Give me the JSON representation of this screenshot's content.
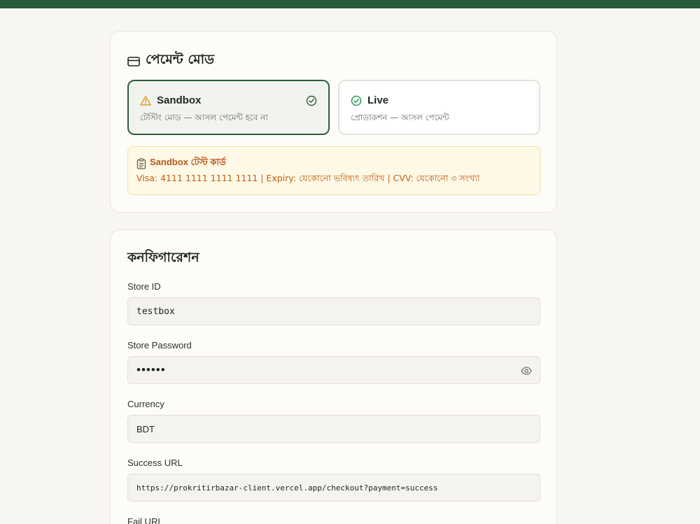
{
  "payment_mode": {
    "title": "পেমেন্ট মোড",
    "options": [
      {
        "label": "Sandbox",
        "description": "টেস্টিং মোড — আসল পেমেন্ট হবে না",
        "selected": true
      },
      {
        "label": "Live",
        "description": "প্রোডাকশন — আসল পেমেন্ট",
        "selected": false
      }
    ],
    "notice": {
      "title": "Sandbox টেস্ট কার্ড",
      "text": "Visa: 4111 1111 1111 1111 | Expiry: যেকোনো ভবিষ্যৎ তারিখ | CVV: যেকোনো ৩ সংখ্যা"
    }
  },
  "configuration": {
    "title": "কনফিগারেশন",
    "fields": {
      "store_id": {
        "label": "Store ID",
        "value": "testbox"
      },
      "store_password": {
        "label": "Store Password",
        "value": "••••••"
      },
      "currency": {
        "label": "Currency",
        "value": "BDT"
      },
      "success_url": {
        "label": "Success URL",
        "value": "https://prokritirbazar-client.vercel.app/checkout?payment=success"
      },
      "fail_url": {
        "label": "Fail URL"
      }
    }
  },
  "colors": {
    "topbar": "#275c38",
    "selected_border": "#2f5d3c",
    "warning": "#e0a21a",
    "success": "#2e9a58",
    "notice_text": "#c26012"
  },
  "icons": [
    "credit-card-icon",
    "warning-icon",
    "check-circle-icon",
    "clipboard-icon",
    "eye-icon"
  ]
}
